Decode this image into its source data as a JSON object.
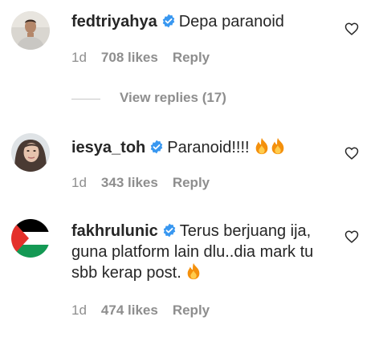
{
  "comments": [
    {
      "username": "fedtriyahya",
      "verified": true,
      "text": "Depa paranoid",
      "time": "1d",
      "likes": "708 likes",
      "reply": "Reply",
      "view_replies": "View replies (17)",
      "avatar_icon": "avatar-man"
    },
    {
      "username": "iesya_toh",
      "verified": true,
      "text": "Paranoid!!!! ",
      "emoji": [
        "fire",
        "fire"
      ],
      "time": "1d",
      "likes": "343 likes",
      "reply": "Reply",
      "avatar_icon": "avatar-woman"
    },
    {
      "username": "fakhrulunic",
      "verified": true,
      "text": "Terus berjuang ija, guna platform lain dlu..dia mark tu sbb kerap post. ",
      "emoji": [
        "fire"
      ],
      "time": "1d",
      "likes": "474 likes",
      "reply": "Reply",
      "avatar_icon": "avatar-palestine-flag"
    }
  ],
  "colors": {
    "text": "#262626",
    "secondary": "#8e8e8e",
    "verified": "#3897f0",
    "divider": "#c7c7c7"
  },
  "icons": {
    "like": "heart-outline-icon",
    "verified": "verified-badge-icon",
    "emoji": "fire-emoji-icon"
  }
}
